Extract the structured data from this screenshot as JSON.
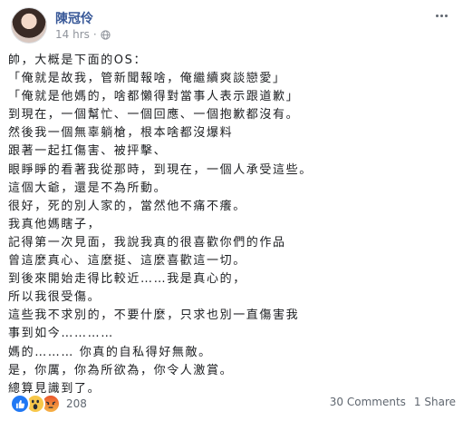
{
  "post": {
    "author": "陳冠伶",
    "timestamp": "14 hrs",
    "visibility_icon": "globe-icon",
    "lines": [
      "帥，大概是下面的OS：",
      "「俺就是故我，管新聞報啥，俺繼續爽談戀愛」",
      "「俺就是他媽的，啥都懶得對當事人表示跟道歉」",
      "到現在，一個幫忙、一個回應、一個抱歉都沒有。",
      "然後我一個無辜躺槍，根本啥都沒爆料",
      "跟著一起扛傷害、被抨擊、",
      "眼睜睜的看著我從那時，到現在，一個人承受這些。",
      "這個大爺，還是不為所動。",
      "很好，死的別人家的，當然他不痛不癢。",
      "我真他媽瞎子，",
      "記得第一次見面，我說我真的很喜歡你們的作品",
      "曾這麼真心、這麼挺、這麼喜歡這一切。",
      "到後來開始走得比較近……我是真心的，",
      "所以我很受傷。",
      "這些我不求別的，不要什麼，只求也別一直傷害我",
      "事到如今…………",
      "媽的……… 你真的自私得好無敵。",
      "是，你厲，你為所欲為，你令人激賞。",
      "總算見識到了。"
    ]
  },
  "footer": {
    "reaction_count": "208",
    "comments": "30 Comments",
    "shares": "1 Share",
    "reaction_icons": [
      "like-icon",
      "wow-icon",
      "angry-icon"
    ]
  },
  "colors": {
    "author": "#385898",
    "meta": "#90949c",
    "like": "#2078f4"
  }
}
